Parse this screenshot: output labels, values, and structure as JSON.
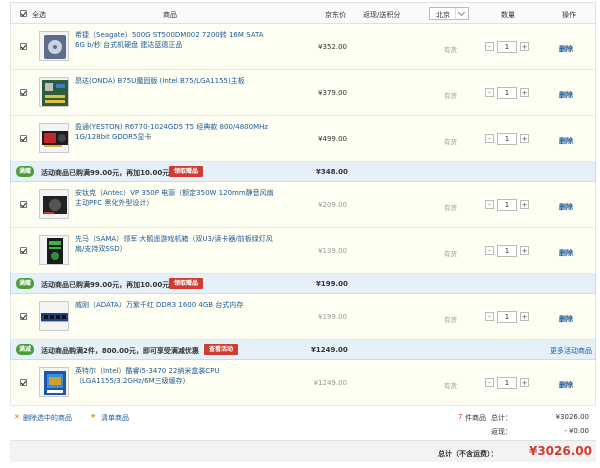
{
  "header": {
    "select_all": "全选",
    "col_product": "商品",
    "col_jd_price": "京东价",
    "col_points": "返现/送积分",
    "region": "北京",
    "col_qty": "数量",
    "col_action": "操作"
  },
  "items": [
    {
      "name": "希捷（Seagate）500G ST500DM002 7200转 16M SATA 6G b/秒 台式机硬盘 建达蓝德正品",
      "price": "¥352.00",
      "stock": "有货",
      "qty": "1",
      "delete": "删除"
    },
    {
      "name": "昂达(ONDA) B75U魔固版 (Intel B75/LGA1155)主板",
      "price": "¥379.00",
      "stock": "有货",
      "qty": "1",
      "delete": "删除"
    },
    {
      "name": "盈通(YESTON) R6770-1024GD5 T5 经典款 800/4800MHz 1G/128bit GDDR5显卡",
      "price": "¥499.00",
      "stock": "有货",
      "qty": "1",
      "delete": "删除"
    },
    {
      "name": "安钛克（Antec）VP 350P 电源（额定350W 120mm静音风扇 主动PFC 黑化外型设计）",
      "price": "¥209.00",
      "stock": "有货",
      "qty": "1",
      "delete": "删除"
    },
    {
      "name": "先马（SAMA）领军 大鹅遥游戏机箱（双U3/读卡器/前板绿灯风扇/支持双SSD）",
      "price": "¥139.00",
      "stock": "有货",
      "qty": "1",
      "delete": "删除"
    },
    {
      "name": "威刚（ADATA）万紫千红 DDR3 1600 4GB 台式内存",
      "price": "¥199.00",
      "stock": "有货",
      "qty": "1",
      "delete": "删除"
    },
    {
      "name": "英特尔（Intel）酷睿i5-3470 22纳米盒装CPU（LGA1155/3.2GHz/6M三级缓存）",
      "price": "¥1249.00",
      "stock": "有货",
      "qty": "1",
      "delete": "删除"
    }
  ],
  "promos": [
    {
      "tag": "满赠",
      "text": "活动商品已购满99.00元，再加10.00元",
      "button": "领取赠品",
      "total": "¥348.00"
    },
    {
      "tag": "满赠",
      "text": "活动商品已购满99.00元，再加10.00元",
      "button": "领取赠品",
      "total": "¥199.00"
    },
    {
      "tag": "满减",
      "text": "活动商品购满2件，800.00元，即可享受满减优惠",
      "button": "查看活动",
      "total": "¥1249.00",
      "more": "更多活动商品"
    }
  ],
  "footer": {
    "delete_selected": "删除选中的商品",
    "list_items": "清单商品",
    "count": "7",
    "count_suffix": "件商品",
    "total_label": "总计：",
    "total_value": "¥3026.00",
    "rebate_label": "返现：",
    "rebate_value": "- ¥0.00",
    "final_label": "总计（不含运费）：",
    "final_value": "¥3026.00"
  },
  "colors": {
    "accent": "#d03c2f",
    "link": "#1a5a9a",
    "promo_bg": "#e6f0f8",
    "promo_tag": "#4a9d37"
  }
}
